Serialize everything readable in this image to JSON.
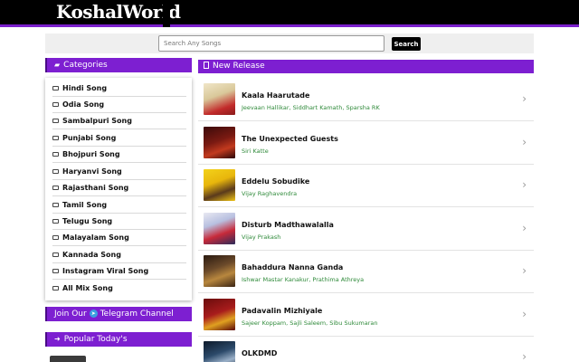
{
  "header": {
    "logo": "KoshalWorld"
  },
  "search": {
    "placeholder": "Search Any Songs",
    "button": "Search"
  },
  "sidebar": {
    "categories_title": "Categories",
    "categories": [
      "Hindi Song",
      "Odia Song",
      "Sambalpuri Song",
      "Punjabi Song",
      "Bhojpuri Song",
      "Haryanvi Song",
      "Rajasthani Song",
      "Tamil Song",
      "Telugu Song",
      "Malayalam Song",
      "Kannada Song",
      "Instagram Viral Song",
      "All Mix Song"
    ],
    "telegram": {
      "prefix": "Join Our",
      "suffix": "Telegram Channel"
    },
    "popular_title": "Popular Today's"
  },
  "main": {
    "title": "New Release",
    "songs": [
      {
        "title": "Kaala Haarutade",
        "artists": "Jeevaan Hallikar, Siddhart Kamath, Sparsha RK"
      },
      {
        "title": "The Unexpected Guests",
        "artists": "Siri Katte"
      },
      {
        "title": "Eddelu Sobudike",
        "artists": "Vijay Raghavendra"
      },
      {
        "title": "Disturb Madthawalalla",
        "artists": "Vijay Prakash"
      },
      {
        "title": "Bahaddura Nanna Ganda",
        "artists": "Ishwar Mastar Kanakur, Prathima Athreya"
      },
      {
        "title": "Padavalin Mizhiyale",
        "artists": "Sajeer Koppam, Sajli Saleem, Sibu Sukumaran"
      },
      {
        "title": "OLKDMD",
        "artists": ""
      }
    ]
  },
  "colors": {
    "accent": "#7d1fd1",
    "artist_text": "#2f8a3a",
    "topbar": "#000000"
  },
  "icons": {
    "category": "folder-icon",
    "row": "chevron-right-icon",
    "telegram": "telegram-icon"
  }
}
